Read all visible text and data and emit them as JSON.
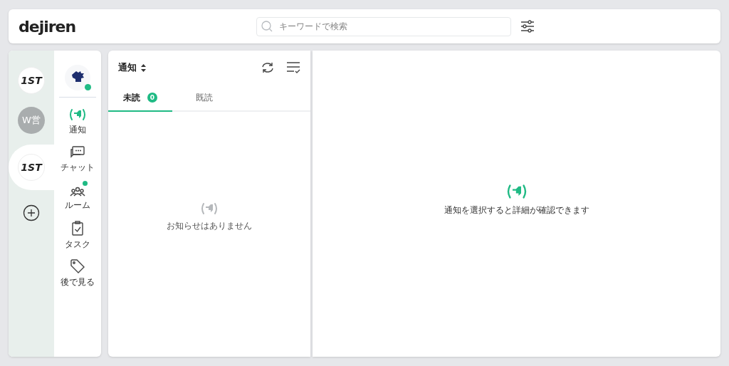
{
  "header": {
    "logo": "dejiren",
    "search": {
      "placeholder": "キーワードで検索"
    }
  },
  "workspaces": [
    {
      "label": "1ST",
      "kind": "logo",
      "selected": false
    },
    {
      "label": "W営",
      "kind": "initials",
      "selected": false
    },
    {
      "label": "1ST",
      "kind": "logo",
      "selected": true
    }
  ],
  "user": {
    "online": true
  },
  "nav": [
    {
      "label": "通知",
      "kind": "notify",
      "selected": true,
      "dot": false
    },
    {
      "label": "チャット",
      "kind": "chat",
      "selected": false,
      "dot": false
    },
    {
      "label": "ルーム",
      "kind": "room",
      "selected": false,
      "dot": true
    },
    {
      "label": "タスク",
      "kind": "task",
      "selected": false,
      "dot": false
    },
    {
      "label": "後で見る",
      "kind": "later",
      "selected": false,
      "dot": false
    }
  ],
  "list": {
    "title": "通知",
    "tabs": [
      {
        "label": "未読",
        "count": "0",
        "selected": true
      },
      {
        "label": "既読",
        "selected": false
      }
    ],
    "empty": "お知らせはありません"
  },
  "detail": {
    "message": "通知を選択すると詳細が確認できます"
  }
}
